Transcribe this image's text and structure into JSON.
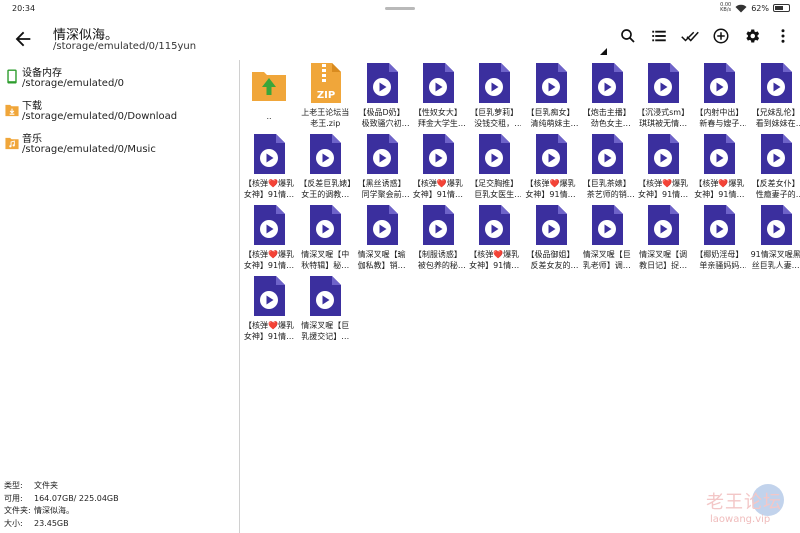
{
  "status_bar": {
    "time": "20:34",
    "net_speed": "0.00",
    "net_unit": "KB/s",
    "battery": "62%",
    "battery_level": 0.62
  },
  "toolbar": {
    "title": "情深似海。",
    "path": "/storage/emulated/0/115yun",
    "icons": [
      "back-arrow-icon",
      "search-icon",
      "list-view-icon",
      "select-all-icon",
      "add-icon",
      "settings-gear-icon",
      "more-vert-icon"
    ]
  },
  "storage": [
    {
      "name": "设备内存",
      "path": "/storage/emulated/0",
      "icon": "phone-icon",
      "color": "#2e9d2e"
    },
    {
      "name": "下载",
      "path": "/storage/emulated/0/Download",
      "icon": "download-folder-icon",
      "color": "#f0a63a"
    },
    {
      "name": "音乐",
      "path": "/storage/emulated/0/Music",
      "icon": "music-folder-icon",
      "color": "#f0a63a"
    }
  ],
  "info": [
    {
      "k": "类型:",
      "v": "文件夹"
    },
    {
      "k": "可用:",
      "v": "164.07GB/ 225.04GB"
    },
    {
      "k": "文件夹:",
      "v": "情深似海。"
    },
    {
      "k": "大小:",
      "v": "23.45GB"
    }
  ],
  "files": [
    {
      "type": "parent",
      "label": ".."
    },
    {
      "type": "zip",
      "label": "上老王论坛当老王.zip"
    },
    {
      "type": "video",
      "label": "【极品D奶】极致骚穴初体…"
    },
    {
      "type": "video",
      "label": "【性奴女大】拜金大学生养…"
    },
    {
      "type": "video",
      "label": "【巨乳萝莉】没钱交租，死…"
    },
    {
      "type": "video",
      "label": "【巨乳痴女】清纯萌妹主打…"
    },
    {
      "type": "video",
      "label": "【炮击主播】劲色女主播，…"
    },
    {
      "type": "video",
      "label": "【沉浸式sm】琪琪被无情…"
    },
    {
      "type": "video",
      "label": "【内射中出】新春与嫂子的…"
    },
    {
      "type": "video",
      "label": "【兄妹乱伦】看到妹妹在家…"
    },
    {
      "type": "video",
      "label": "【核弹❤️爆乳女神】91情…"
    },
    {
      "type": "video",
      "label": "【反差巨乳婊】女王的调教…"
    },
    {
      "type": "video",
      "label": "【黑丝诱惑】同学聚会前与…"
    },
    {
      "type": "video",
      "label": "【核弹❤️爆乳女神】91情…"
    },
    {
      "type": "video",
      "label": "【足交胸推】巨乳女医生早…"
    },
    {
      "type": "video",
      "label": "【核弹❤️爆乳女神】91情…"
    },
    {
      "type": "video",
      "label": "【巨乳茶婊】茶艺师的销售…"
    },
    {
      "type": "video",
      "label": "【核弹❤️爆乳女神】91情…"
    },
    {
      "type": "video",
      "label": "【核弹❤️爆乳女神】91情…"
    },
    {
      "type": "video",
      "label": "【反差女仆】性瘾妻子的限…"
    },
    {
      "type": "video",
      "label": "【核弹❤️爆乳女神】91情…"
    },
    {
      "type": "video",
      "label": "情深叉喔【中秋特辑】秘…"
    },
    {
      "type": "video",
      "label": "情深叉喔【瑜伽私教】销…"
    },
    {
      "type": "video",
      "label": "【制服诱惑】被包养的秘书…"
    },
    {
      "type": "video",
      "label": "【核弹❤️爆乳女神】91情…"
    },
    {
      "type": "video",
      "label": "【极品御姐】反差女友的双…"
    },
    {
      "type": "video",
      "label": "情深叉喔【巨乳老师】调…"
    },
    {
      "type": "video",
      "label": "情深叉喔【调教日记】捉…"
    },
    {
      "type": "video",
      "label": "【椰奶淫母】单亲骚妈妈对…"
    },
    {
      "type": "video",
      "label": "91情深叉喔黑丝巨乳人妻…"
    },
    {
      "type": "video",
      "label": "【核弹❤️爆乳女神】91情…"
    },
    {
      "type": "video",
      "label": "情深叉喔【巨乳援交记】…"
    }
  ],
  "watermark": {
    "top": "老王论坛",
    "bottom": "laowang.vip"
  },
  "colors": {
    "video_icon": "#3b2f9e",
    "folder": "#f0a63a",
    "zip": "#f0a63a",
    "divider": "#d0d0d0"
  }
}
